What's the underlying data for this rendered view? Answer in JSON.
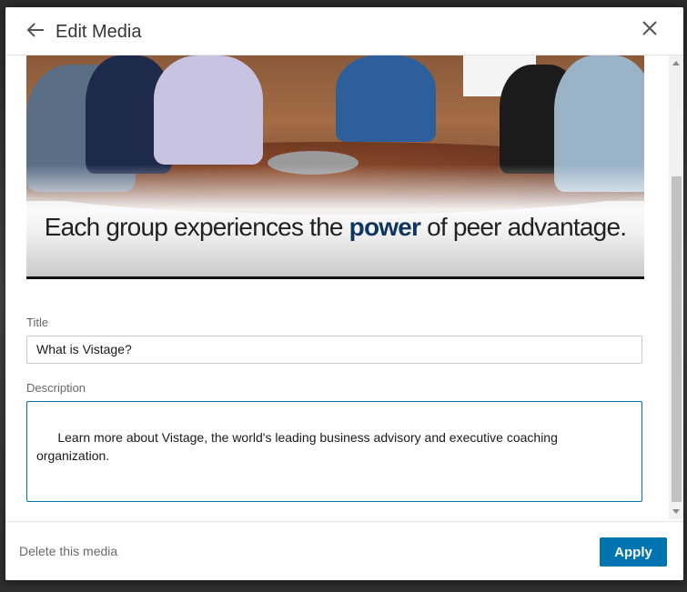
{
  "header": {
    "title": "Edit Media",
    "back_icon": "arrow-left-icon",
    "close_icon": "close-icon"
  },
  "media": {
    "caption_prefix": "Each group experiences the ",
    "caption_bold": "power",
    "caption_suffix": " of peer advantage."
  },
  "form": {
    "title_label": "Title",
    "title_value": "What is Vistage?",
    "description_label": "Description",
    "description_value": "Learn more about Vistage, the world's leading business advisory and executive coaching organization."
  },
  "footer": {
    "delete_label": "Delete this media",
    "apply_label": "Apply"
  },
  "colors": {
    "accent": "#0073b1"
  }
}
